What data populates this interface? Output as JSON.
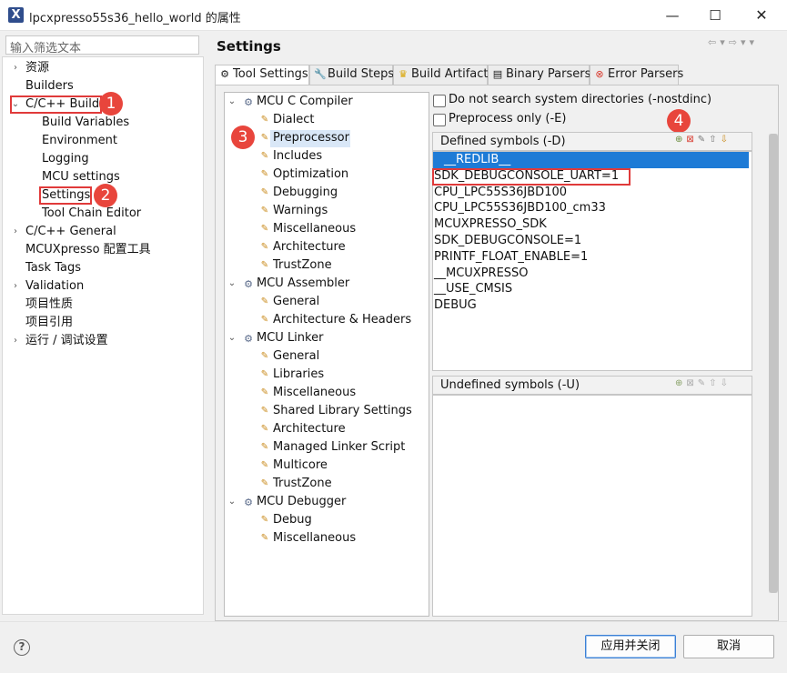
{
  "window": {
    "title": "lpcxpresso55s36_hello_world 的属性",
    "app_icon_glyph": "X"
  },
  "left": {
    "filter_placeholder": "输入筛选文本",
    "items": [
      {
        "label": "资源",
        "expand": "›"
      },
      {
        "label": "Builders"
      },
      {
        "label": "C/C++ Build",
        "expand": "⌄"
      },
      {
        "label": "Build Variables"
      },
      {
        "label": "Environment"
      },
      {
        "label": "Logging"
      },
      {
        "label": "MCU settings"
      },
      {
        "label": "Settings"
      },
      {
        "label": "Tool Chain Editor"
      },
      {
        "label": "C/C++ General",
        "expand": "›"
      },
      {
        "label": "MCUXpresso 配置工具"
      },
      {
        "label": "Task Tags"
      },
      {
        "label": "Validation",
        "expand": "›"
      },
      {
        "label": "项目性质"
      },
      {
        "label": "项目引用"
      },
      {
        "label": "运行 / 调试设置",
        "expand": "›"
      }
    ]
  },
  "badges": [
    "1",
    "2",
    "3",
    "4"
  ],
  "settings": {
    "title": "Settings",
    "tabs": [
      {
        "label": "Tool Settings",
        "icon": "gear-icon"
      },
      {
        "label": "Build Steps",
        "icon": "wrench-icon"
      },
      {
        "label": "Build Artifact",
        "icon": "trophy-icon"
      },
      {
        "label": "Binary Parsers",
        "icon": "binary-icon"
      },
      {
        "label": "Error Parsers",
        "icon": "error-icon"
      }
    ]
  },
  "tool_tree": [
    {
      "label": "MCU C Compiler",
      "type": "group"
    },
    {
      "label": "Dialect",
      "type": "leaf"
    },
    {
      "label": "Preprocessor",
      "type": "leaf",
      "selected": true
    },
    {
      "label": "Includes",
      "type": "leaf"
    },
    {
      "label": "Optimization",
      "type": "leaf"
    },
    {
      "label": "Debugging",
      "type": "leaf"
    },
    {
      "label": "Warnings",
      "type": "leaf"
    },
    {
      "label": "Miscellaneous",
      "type": "leaf"
    },
    {
      "label": "Architecture",
      "type": "leaf"
    },
    {
      "label": "TrustZone",
      "type": "leaf"
    },
    {
      "label": "MCU Assembler",
      "type": "group"
    },
    {
      "label": "General",
      "type": "leaf"
    },
    {
      "label": "Architecture & Headers",
      "type": "leaf"
    },
    {
      "label": "MCU Linker",
      "type": "group"
    },
    {
      "label": "General",
      "type": "leaf"
    },
    {
      "label": "Libraries",
      "type": "leaf"
    },
    {
      "label": "Miscellaneous",
      "type": "leaf"
    },
    {
      "label": "Shared Library Settings",
      "type": "leaf"
    },
    {
      "label": "Architecture",
      "type": "leaf"
    },
    {
      "label": "Managed Linker Script",
      "type": "leaf"
    },
    {
      "label": "Multicore",
      "type": "leaf"
    },
    {
      "label": "TrustZone",
      "type": "leaf"
    },
    {
      "label": "MCU Debugger",
      "type": "group"
    },
    {
      "label": "Debug",
      "type": "leaf"
    },
    {
      "label": "Miscellaneous",
      "type": "leaf"
    }
  ],
  "options": {
    "nostdinc_label": "Do not search system directories (-nostdinc)",
    "nostdinc_checked": false,
    "preprocess_label": "Preprocess only (-E)",
    "preprocess_checked": false
  },
  "defined": {
    "header": "Defined symbols (-D)",
    "symbols": [
      "__REDLIB__",
      "SDK_DEBUGCONSOLE_UART=1",
      "CPU_LPC55S36JBD100",
      "CPU_LPC55S36JBD100_cm33",
      "MCUXPRESSO_SDK",
      "SDK_DEBUGCONSOLE=1",
      "PRINTF_FLOAT_ENABLE=1",
      "__MCUXPRESSO",
      "__USE_CMSIS",
      "DEBUG"
    ]
  },
  "undefined": {
    "header": "Undefined symbols (-U)",
    "symbols": []
  },
  "footer": {
    "apply_close": "应用并关闭",
    "cancel": "取消",
    "help_glyph": "?"
  },
  "colors": {
    "highlight": "#e03a3a",
    "selection": "#1e7bd6",
    "accent": "#3b80d6"
  }
}
